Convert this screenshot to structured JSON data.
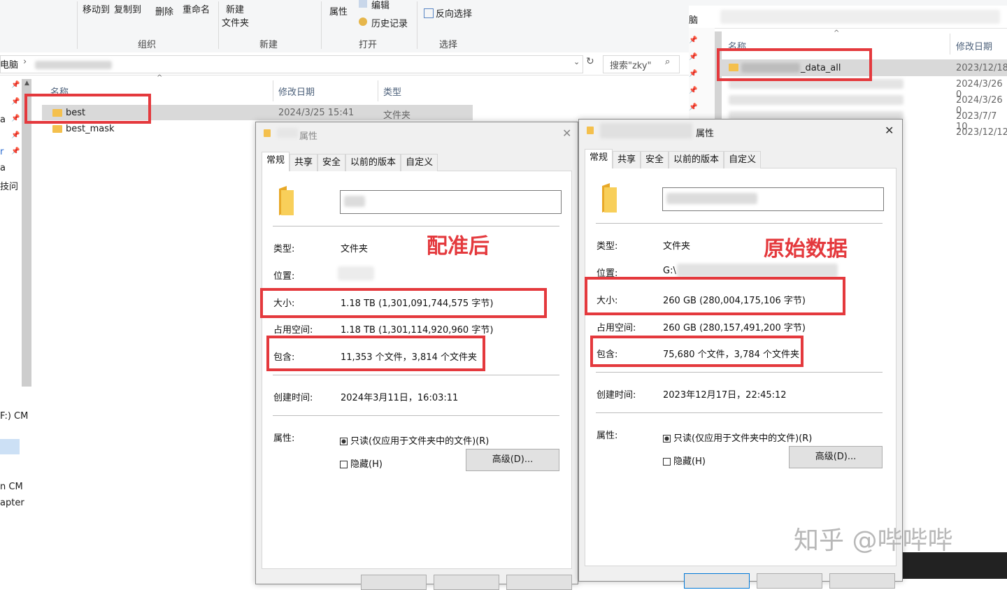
{
  "ribbon": {
    "move_to": "移动到",
    "copy_to": "复制到",
    "delete": "删除",
    "rename": "重命名",
    "new_folder_line1": "新建",
    "new_folder_line2": "文件夹",
    "properties": "属性",
    "edit": "编辑",
    "history": "历史记录",
    "invert_select": "反向选择",
    "group_organize": "组织",
    "group_new": "新建",
    "group_open": "打开",
    "group_select": "选择"
  },
  "address": {
    "root": "电脑",
    "search_placeholder": "搜索\"zky\""
  },
  "left_nav": {
    "items": [
      "a",
      "r",
      "a",
      "技问",
      "F:) CM",
      "n CM",
      "apter"
    ]
  },
  "file_list": {
    "col_name": "名称",
    "col_modified": "修改日期",
    "col_type": "类型",
    "rows": [
      {
        "name": "best",
        "modified": "2024/3/25 15:41",
        "type": "文件夹"
      },
      {
        "name": "best_mask",
        "modified": "",
        "type": ""
      }
    ]
  },
  "right_explorer": {
    "breadcrumb": "脑",
    "col_name": "名称",
    "col_modified": "修改日期",
    "rows": [
      {
        "name": "_data_all",
        "modified": "2023/12/18"
      },
      {
        "name": "",
        "modified": "2024/3/26 0"
      },
      {
        "name": "",
        "modified": "2024/3/26 0"
      },
      {
        "name": "",
        "modified": "2023/7/7 10"
      },
      {
        "name": "",
        "modified": "2023/12/12"
      }
    ]
  },
  "dialog_left": {
    "title": "属性",
    "tabs": [
      "常规",
      "共享",
      "安全",
      "以前的版本",
      "自定义"
    ],
    "annotation": "配准后",
    "labels": {
      "type": "类型:",
      "location": "位置:",
      "size": "大小:",
      "size_on_disk": "占用空间:",
      "contains": "包含:",
      "created": "创建时间:",
      "attributes": "属性:"
    },
    "values": {
      "type": "文件夹",
      "size": "1.18 TB (1,301,091,744,575 字节)",
      "size_on_disk": "1.18 TB (1,301,114,920,960 字节)",
      "contains": "11,353 个文件，3,814 个文件夹",
      "created": "2024年3月11日，16:03:11"
    },
    "readonly": "只读(仅应用于文件夹中的文件)(R)",
    "hidden": "隐藏(H)",
    "advanced": "高级(D)..."
  },
  "dialog_right": {
    "title": "属性",
    "tabs": [
      "常规",
      "共享",
      "安全",
      "以前的版本",
      "自定义"
    ],
    "annotation": "原始数据",
    "labels": {
      "type": "类型:",
      "location": "位置:",
      "size": "大小:",
      "size_on_disk": "占用空间:",
      "contains": "包含:",
      "created": "创建时间:",
      "attributes": "属性:"
    },
    "values": {
      "type": "文件夹",
      "location": "G:\\",
      "size": "260 GB (280,004,175,106 字节)",
      "size_on_disk": "260 GB (280,157,491,200 字节)",
      "contains": "75,680 个文件，3,784 个文件夹",
      "created": "2023年12月17日，22:45:12"
    },
    "readonly": "只读(仅应用于文件夹中的文件)(R)",
    "hidden": "隐藏(H)",
    "advanced": "高级(D)..."
  },
  "watermark": "知乎 @哔哔哔",
  "colors": {
    "highlight_red": "#e4393d",
    "folder_yellow": "#f4c04d"
  }
}
